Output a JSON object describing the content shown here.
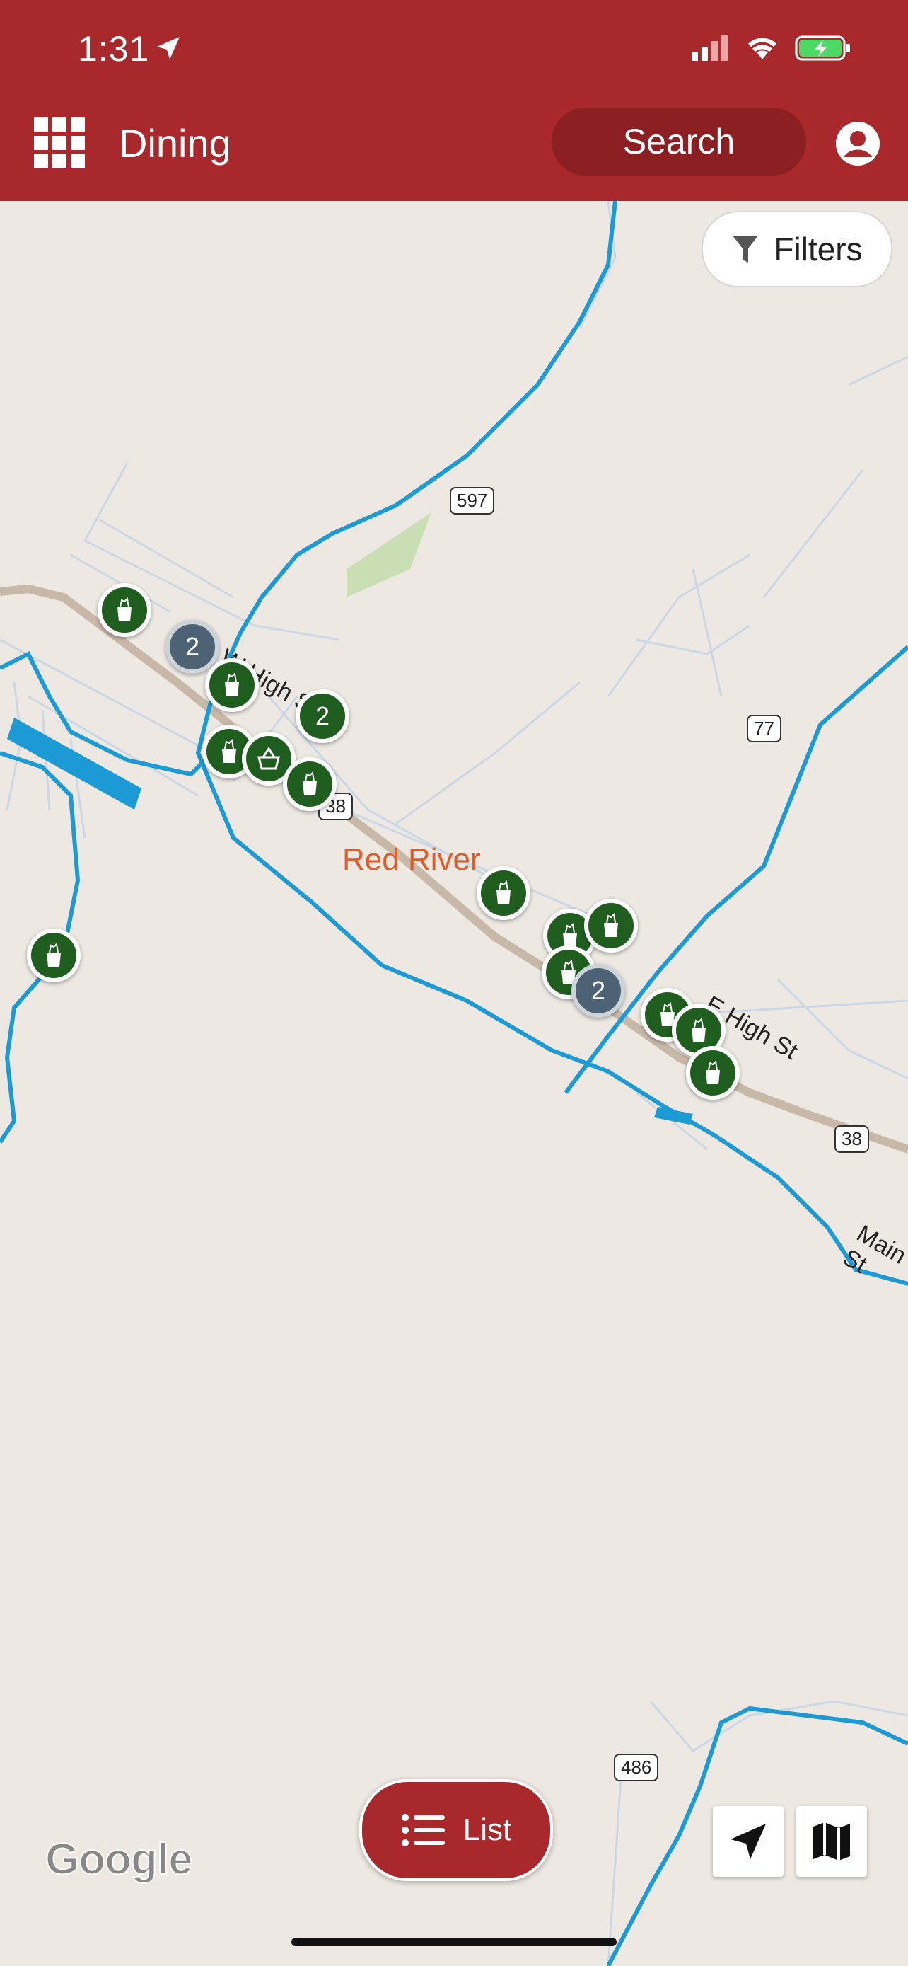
{
  "status": {
    "time": "1:31"
  },
  "header": {
    "title": "Dining",
    "search_label": "Search"
  },
  "filters": {
    "label": "Filters"
  },
  "map": {
    "place_label": "Red River",
    "streets": [
      "W High St",
      "E High St",
      "Main St"
    ],
    "routes": [
      "597",
      "77",
      "38",
      "38",
      "486"
    ],
    "clusters": [
      "2",
      "2",
      "2"
    ],
    "attribution": "Google"
  },
  "list_button": {
    "label": "List"
  },
  "colors": {
    "brand": "#a8282b",
    "marker": "#1f5e1f",
    "cluster": "#4d6275",
    "river": "#1b9ad6",
    "road": "#c8b8a8"
  },
  "icons": [
    "navigation-arrow-icon",
    "signal-icon",
    "wifi-icon",
    "battery-icon",
    "menu-grid-icon",
    "account-icon",
    "filter-icon",
    "grocery-bag-icon",
    "basket-icon",
    "list-icon",
    "location-arrow-icon",
    "map-icon"
  ]
}
